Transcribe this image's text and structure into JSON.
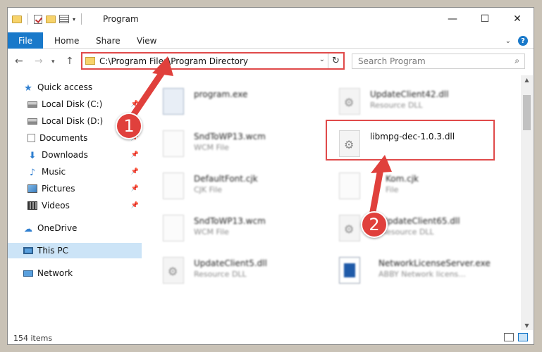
{
  "window": {
    "title": "Program"
  },
  "ribbon": {
    "tabs": [
      "File",
      "Home",
      "Share",
      "View"
    ]
  },
  "address": {
    "path": "C:\\Program Files\\Program Directory"
  },
  "search": {
    "placeholder": "Search Program"
  },
  "sidebar": {
    "items": [
      {
        "label": "Quick access",
        "icon": "star-icon"
      },
      {
        "label": "Local Disk (C:)",
        "icon": "drive-icon"
      },
      {
        "label": "Local Disk (D:)",
        "icon": "drive-icon"
      },
      {
        "label": "Documents",
        "icon": "documents-icon"
      },
      {
        "label": "Downloads",
        "icon": "downloads-icon"
      },
      {
        "label": "Music",
        "icon": "music-icon"
      },
      {
        "label": "Pictures",
        "icon": "pictures-icon"
      },
      {
        "label": "Videos",
        "icon": "videos-icon"
      },
      {
        "label": "OneDrive",
        "icon": "cloud-icon"
      },
      {
        "label": "This PC",
        "icon": "computer-icon"
      },
      {
        "label": "Network",
        "icon": "network-icon"
      }
    ]
  },
  "files": [
    {
      "name": "program.exe",
      "type": ""
    },
    {
      "name": "UpdateClient42.dll",
      "type": "Resource DLL"
    },
    {
      "name": "SndToWP13.wcm",
      "type": "WCM File"
    },
    {
      "name": "libmpg-dec-1.0.3.dll",
      "type": ""
    },
    {
      "name": "DefaultFont.cjk",
      "type": "CJK File"
    },
    {
      "name": "Kom.cjk",
      "type": "File"
    },
    {
      "name": "SndToWP13.wcm",
      "type": "WCM File"
    },
    {
      "name": "UpdateClient65.dll",
      "type": "Resource DLL"
    },
    {
      "name": "UpdateClient5.dll",
      "type": "Resource DLL"
    },
    {
      "name": "NetworkLicenseServer.exe",
      "type": "ABBY Network licens..."
    }
  ],
  "status": {
    "item_count": "154 items"
  },
  "callouts": [
    "1",
    "2"
  ],
  "colors": {
    "accent": "#1979ca",
    "highlight": "#e04a4a",
    "selected": "#cce4f7"
  }
}
